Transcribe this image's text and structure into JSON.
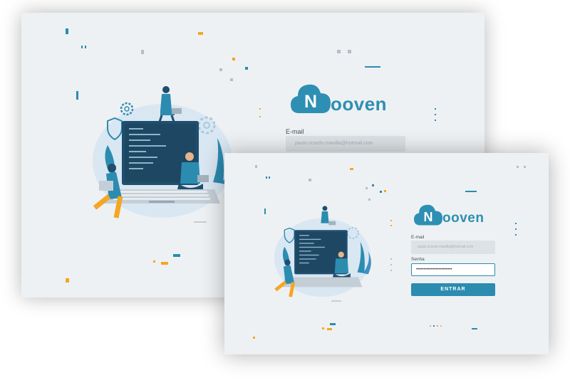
{
  "brand": {
    "initial": "N",
    "name_rest": "ooven",
    "logo_color": "#2d8fb3"
  },
  "back_screen": {
    "email_label": "E-mail",
    "email_value": "paulo.ricardo.manilla@hotmail.com"
  },
  "front_screen": {
    "email_label": "E-mail",
    "email_value": "paulo.ricardo.manilla@hotmail.com",
    "password_label": "Senha",
    "password_value": "••••••••••••••••••••••••",
    "submit_label": "ENTRAR"
  },
  "colors": {
    "accent": "#2b8cb0",
    "background": "#eef1f3",
    "decor_orange": "#f5a623",
    "illustration_dark": "#1f4e6e"
  },
  "icons": [
    "cloud-logo-icon",
    "shield-icon",
    "gear-icon",
    "laptop-illustration"
  ]
}
